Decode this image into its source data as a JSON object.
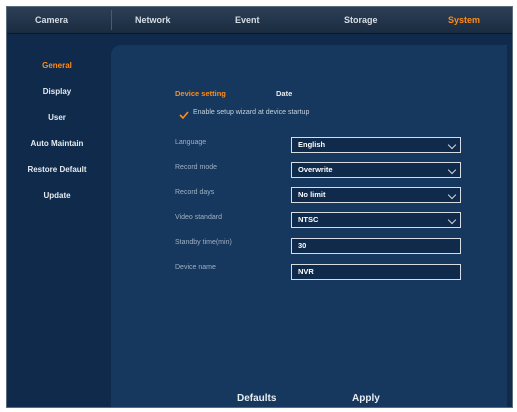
{
  "tabs": [
    "Camera",
    "Network",
    "Event",
    "Storage",
    "System"
  ],
  "active_tab": "System",
  "sidebar": {
    "items": [
      "General",
      "Display",
      "User",
      "Auto Maintain",
      "Restore Default",
      "Update"
    ],
    "active": "General"
  },
  "panel": {
    "subtab_active": "Device setting",
    "subtab_other": "Date",
    "wizard_checkbox_label": "Enable setup wizard at device startup",
    "wizard_checked": true,
    "fields": {
      "language": {
        "label": "Language",
        "value": "English"
      },
      "record_mode": {
        "label": "Record mode",
        "value": "Overwrite"
      },
      "record_days": {
        "label": "Record days",
        "value": "No limit"
      },
      "video_standard": {
        "label": "Video standard",
        "value": "NTSC"
      },
      "standby_time": {
        "label": "Standby time(min)",
        "value": "30"
      },
      "device_name": {
        "label": "Device name",
        "value": "NVR"
      }
    }
  },
  "footer": {
    "defaults_label": "Defaults",
    "apply_label": "Apply"
  },
  "colors": {
    "accent": "#ff8c1a",
    "panel": "#16385e",
    "background": "#0f2a4b"
  }
}
